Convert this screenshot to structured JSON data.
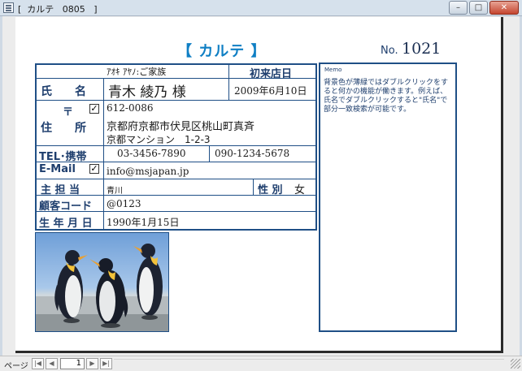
{
  "window": {
    "title": "[  カルテ   0805   ]",
    "minimize_glyph": "–",
    "maximize_glyph": "□",
    "close_glyph": "✕"
  },
  "header": {
    "title": "【  カルテ  】",
    "no_label": "No.",
    "no_value": "1021"
  },
  "form": {
    "furigana": "ｱｵｷ ｱﾔﾉ:ご家族",
    "name_label": "氏　　名",
    "name_value": "青木  綾乃  様",
    "first_visit_label": "初来店日",
    "first_visit_value": "2009年6月10日",
    "zip_label": "〒",
    "zip_checked": true,
    "zip_value": "612-0086",
    "address_label": "住　　所",
    "address_line1": "京都府京都市伏見区桃山町真斉",
    "address_line2": "京都マンション　1-2-3",
    "tel_label": "TEL･携帯",
    "tel_value": "03-3456-7890",
    "mobile_value": "090-1234-5678",
    "email_label": "E-Mail",
    "email_checked": true,
    "email_value": "info@msjapan.jp",
    "staff_label": "主 担 当",
    "staff_value": "青川",
    "gender_label": "性 別",
    "gender_value": "女",
    "customer_code_label": "顧客コード",
    "customer_code_value": "@0123",
    "birthday_label": "生 年 月 日",
    "birthday_value": "1990年1月15日"
  },
  "memo": {
    "label": "Memo",
    "text": "背景色が薄緑ではダブルクリックをすると何かの機能が働きます。例えば、氏名でダブルクリックすると\"氏名\"で部分一致検索が可能です。"
  },
  "photo": {
    "subject": "penguins"
  },
  "navigation": {
    "page_label": "ページ",
    "current_page": "1",
    "first_glyph": "|◀",
    "prev_glyph": "◀",
    "next_glyph": "▶",
    "last_glyph": "▶|"
  },
  "colors": {
    "accent": "#0f7fc4",
    "border": "#1f4f86",
    "label": "#1f3f6e"
  }
}
